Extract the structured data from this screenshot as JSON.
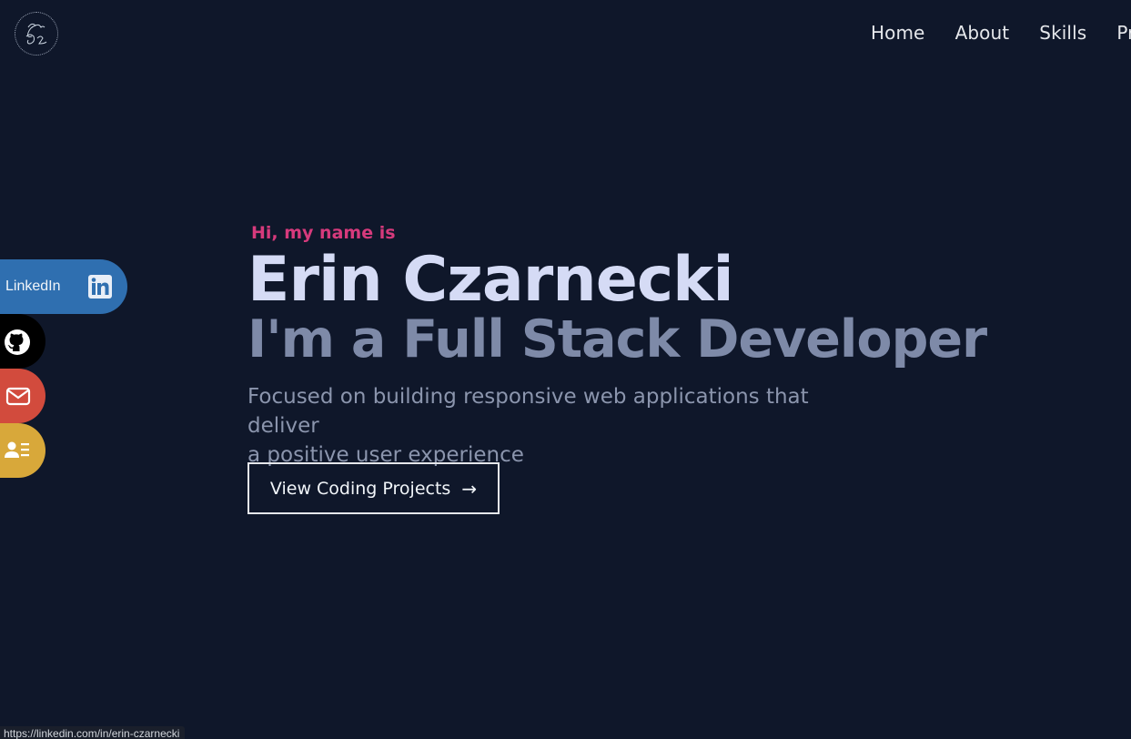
{
  "logo": {
    "text": "Erin Cz",
    "icon": "signature-logo"
  },
  "nav": {
    "items": [
      {
        "label": "Home"
      },
      {
        "label": "About"
      },
      {
        "label": "Skills"
      },
      {
        "label": "Pro"
      }
    ]
  },
  "social": {
    "linkedin": {
      "label": "LinkedIn",
      "icon": "linkedin-icon",
      "color": "#2f6fb0"
    },
    "github": {
      "icon": "github-icon",
      "color": "#000000"
    },
    "email": {
      "icon": "envelope-icon",
      "color": "#d24b3d"
    },
    "resume": {
      "icon": "contact-card-icon",
      "color": "#d8a83a"
    }
  },
  "hero": {
    "greeting": "Hi, my name is",
    "name": "Erin Czarnecki",
    "role": "I'm a Full Stack Developer",
    "tagline_line1": "Focused on building responsive web applications that deliver",
    "tagline_line2": "a positive user experience",
    "cta_label": "View Coding Projects",
    "cta_arrow": "→"
  },
  "status_bar": {
    "url": "https://linkedin.com/in/erin-czarnecki"
  },
  "colors": {
    "background": "#0f172a",
    "accent_pink": "#d63a7c",
    "name_color": "#d5dbf5",
    "role_color": "#7e8aa8"
  }
}
